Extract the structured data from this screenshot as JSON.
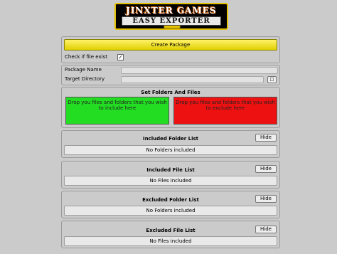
{
  "logo": {
    "title": "JINXTER GAMES",
    "subtitle": "EASY EXPORTER"
  },
  "create": {
    "label": "Create Package",
    "check_label": "Check if file exist",
    "checked": true
  },
  "package": {
    "name_label": "Package Name",
    "name_value": "",
    "dir_label": "Target Directory",
    "dir_value": "",
    "browse_label": "□"
  },
  "folders": {
    "title": "Set Folders And Files",
    "include_drop": "Drop you files and folders that you wish to include here",
    "exclude_drop": "Drop you files and folders that you wish to exclude here"
  },
  "lists": [
    {
      "title": "Included Folder List",
      "hide": "Hide",
      "empty": "No Folders included"
    },
    {
      "title": "Included File List",
      "hide": "Hide",
      "empty": "No Files included"
    },
    {
      "title": "Excluded Folder List",
      "hide": "Hide",
      "empty": "No Folders included"
    },
    {
      "title": "Excluded File List",
      "hide": "Hide",
      "empty": "No Files included"
    }
  ]
}
